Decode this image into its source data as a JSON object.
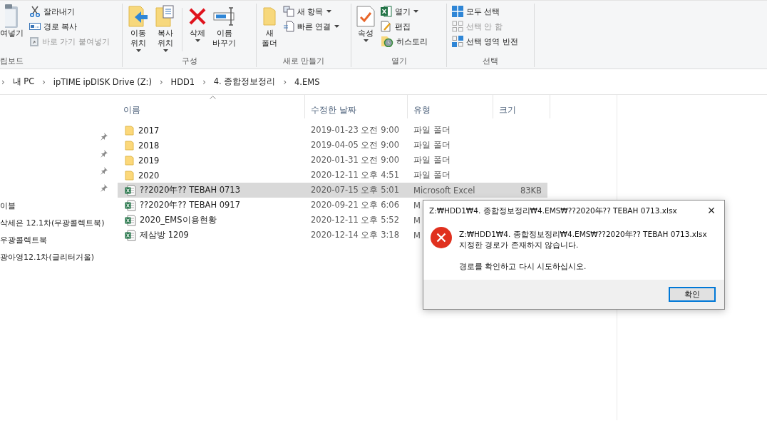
{
  "ribbon": {
    "groups": [
      {
        "label": "립보드",
        "large": [
          {
            "lines": [
              "여넣기"
            ],
            "dropdown": false,
            "disabled": false
          }
        ],
        "small": [
          {
            "label": "잘라내기",
            "dropdown": false,
            "disabled": false
          },
          {
            "label": "경로 복사",
            "dropdown": false,
            "disabled": false
          },
          {
            "label": "바로 가기 붙여넣기",
            "dropdown": false,
            "disabled": true
          }
        ]
      },
      {
        "label": "구성",
        "large": [
          {
            "lines": [
              "이동",
              "위치"
            ],
            "dropdown": true,
            "disabled": false
          },
          {
            "lines": [
              "복사",
              "위치"
            ],
            "dropdown": true,
            "disabled": false
          },
          {
            "lines": [
              "삭제"
            ],
            "dropdown": true,
            "disabled": false
          },
          {
            "lines": [
              "이름",
              "바꾸기"
            ],
            "dropdown": false,
            "disabled": false
          }
        ]
      },
      {
        "label": "새로 만들기",
        "large": [
          {
            "lines": [
              "새",
              "폴더"
            ],
            "dropdown": false,
            "disabled": false
          }
        ],
        "small": [
          {
            "label": "새 항목",
            "dropdown": true,
            "disabled": false
          },
          {
            "label": "빠른 연결",
            "dropdown": true,
            "disabled": false
          }
        ]
      },
      {
        "label": "열기",
        "large": [
          {
            "lines": [
              "속성"
            ],
            "dropdown": true,
            "disabled": false
          }
        ],
        "small": [
          {
            "label": "열기",
            "dropdown": true,
            "disabled": false
          },
          {
            "label": "편집",
            "dropdown": false,
            "disabled": false
          },
          {
            "label": "히스토리",
            "dropdown": false,
            "disabled": false
          }
        ]
      },
      {
        "label": "선택",
        "small": [
          {
            "label": "모두 선택",
            "dropdown": false,
            "disabled": false
          },
          {
            "label": "선택 안 함",
            "dropdown": false,
            "disabled": true
          },
          {
            "label": "선택 영역 반전",
            "dropdown": false,
            "disabled": false
          }
        ]
      }
    ]
  },
  "address_bar": {
    "crumbs": [
      "내 PC",
      "ipTIME ipDISK Drive (Z:)",
      "HDD1",
      "4. 종합정보정리",
      "4.EMS"
    ],
    "separator": "›"
  },
  "navigation": {
    "items": [
      {
        "pinned": true
      },
      {
        "pinned": true
      },
      {
        "pinned": true
      },
      {
        "pinned": true
      },
      {
        "label": "이블",
        "pinned": false
      },
      {
        "label": "삭세은 12.1차(무광콜렉트북)",
        "pinned": false
      },
      {
        "label": "우광콜렉트북",
        "pinned": false
      },
      {
        "label": "광아영12.1차(글리터거울)",
        "pinned": false
      }
    ]
  },
  "file_list": {
    "columns": [
      "이름",
      "수정한 날짜",
      "유형",
      "크기"
    ],
    "rows": [
      {
        "kind": "folder",
        "name": "2017",
        "modified": "2019-01-23 오전 9:00",
        "type": "파일 폴더",
        "selected": false
      },
      {
        "kind": "folder",
        "name": "2018",
        "modified": "2019-04-05 오전 9:00",
        "type": "파일 폴더",
        "selected": false
      },
      {
        "kind": "folder",
        "name": "2019",
        "modified": "2020-01-31 오전 9:00",
        "type": "파일 폴더",
        "selected": false
      },
      {
        "kind": "folder",
        "name": "2020",
        "modified": "2020-12-11 오후 4:51",
        "type": "파일 폴더",
        "selected": false
      },
      {
        "kind": "excel",
        "name": "??2020年?? TEBAH 0713",
        "modified": "2020-07-15 오후 5:01",
        "type": "Microsoft Excel",
        "size": "83KB",
        "selected": true
      },
      {
        "kind": "excel",
        "name": "??2020年?? TEBAH 0917",
        "modified": "2020-09-21 오후 6:06",
        "type": "M",
        "selected": false
      },
      {
        "kind": "excel",
        "name": "2020_EMS이용현황",
        "modified": "2020-12-11 오후 5:52",
        "type": "M",
        "selected": false
      },
      {
        "kind": "excel",
        "name": "제삼방 1209",
        "modified": "2020-12-14 오후 3:18",
        "type": "M",
        "selected": false
      }
    ]
  },
  "dialog": {
    "title": "Z:₩HDD1₩4. 종합정보정리₩4.EMS₩??2020年?? TEBAH 0713.xlsx",
    "close": "×",
    "message": [
      "Z:₩HDD1₩4. 종합정보정리₩4.EMS₩??2020年?? TEBAH 0713.xlsx",
      "지정한 경로가 존재하지 않습니다."
    ],
    "hint": "경로를 확인하고 다시 시도하십시오.",
    "buttons": [
      {
        "label": "확인",
        "default": true
      }
    ]
  }
}
